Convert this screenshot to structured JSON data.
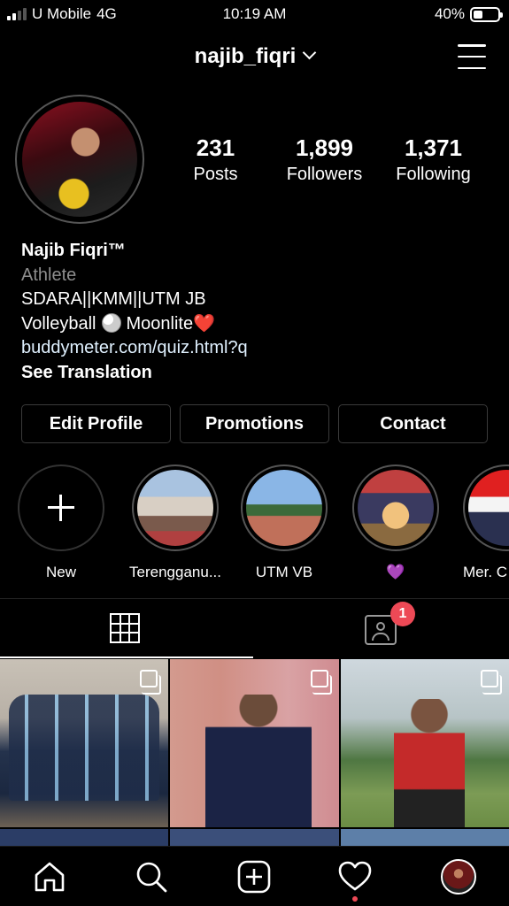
{
  "status_bar": {
    "carrier": "U Mobile",
    "network": "4G",
    "time": "10:19 AM",
    "battery": "40%",
    "battery_level": 0.4
  },
  "header": {
    "username": "najib_fiqri"
  },
  "profile": {
    "stats": [
      {
        "value": "231",
        "label": "Posts"
      },
      {
        "value": "1,899",
        "label": "Followers"
      },
      {
        "value": "1,371",
        "label": "Following"
      }
    ],
    "name": "Najib Fiqri™",
    "category": "Athlete",
    "bio_line1": "SDARA||KMM||UTM JB",
    "bio_line2_a": "Volleyball",
    "bio_line2_b": "Moonlite",
    "bio_line2_emoji": "❤️",
    "link": "buddymeter.com/quiz.html?q",
    "see_translation": "See Translation"
  },
  "actions": {
    "edit_profile": "Edit Profile",
    "promotions": "Promotions",
    "contact": "Contact"
  },
  "highlights": [
    {
      "label": "New"
    },
    {
      "label": "Terengganu..."
    },
    {
      "label": "UTM VB"
    },
    {
      "label": "💜"
    },
    {
      "label": "Mer. C"
    }
  ],
  "tabs": {
    "tagged_badge": "1"
  },
  "colors": {
    "background": "#000000",
    "badge": "#ed4956",
    "link": "#e0f1ff",
    "secondary_text": "#8e8e8e"
  },
  "icons": [
    "signal-icon",
    "battery-icon",
    "chevron-down-icon",
    "menu-icon",
    "plus-icon",
    "grid-icon",
    "tagged-icon",
    "multi-post-icon",
    "home-icon",
    "search-icon",
    "add-post-icon",
    "heart-icon",
    "profile-avatar-icon"
  ]
}
